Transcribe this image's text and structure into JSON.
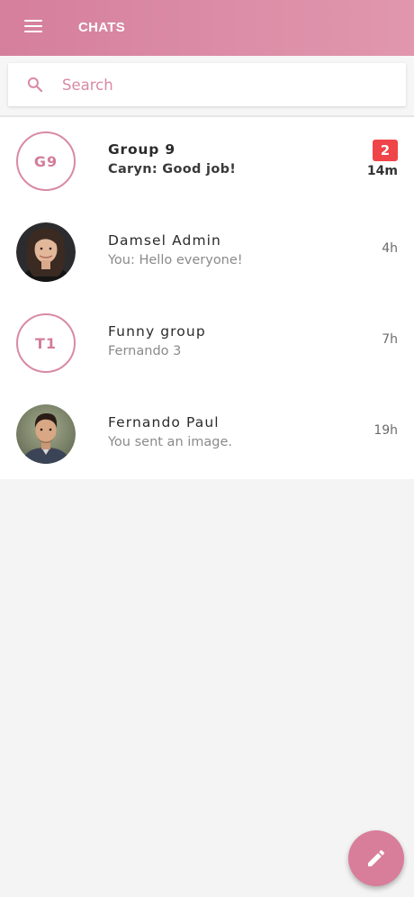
{
  "header": {
    "title": "CHATS",
    "menu_icon": "hamburger-menu-icon",
    "gradient_start": "#d57f9d",
    "gradient_end": "#e197ae"
  },
  "search": {
    "placeholder": "Search",
    "value": "",
    "icon": "search-icon"
  },
  "chats": [
    {
      "avatar_type": "initials",
      "initials": "G9",
      "name": "Group 9",
      "preview": "Caryn: Good job!",
      "time": "14m",
      "unread_count": "2",
      "bold": true
    },
    {
      "avatar_type": "photo",
      "name": "Damsel Admin",
      "preview": "You: Hello everyone!",
      "time": "4h",
      "bold": false
    },
    {
      "avatar_type": "initials",
      "initials": "T1",
      "name": "Funny group",
      "preview": "Fernando 3",
      "time": "7h",
      "bold": false
    },
    {
      "avatar_type": "photo",
      "name": "Fernando Paul",
      "preview": "You sent an image.",
      "time": "19h",
      "bold": false
    }
  ],
  "fab": {
    "icon": "pencil-icon",
    "color": "#d87d9a"
  },
  "colors": {
    "accent": "#d98aa5",
    "badge": "#ef4448",
    "background": "#f4f4f4"
  }
}
